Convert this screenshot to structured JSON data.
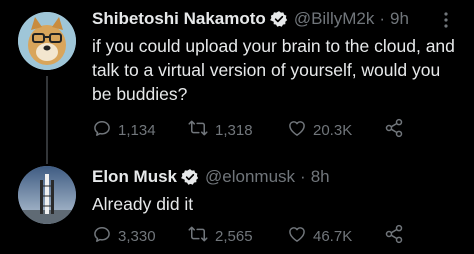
{
  "tweets": [
    {
      "name": "Shibetoshi Nakamoto",
      "handle": "@BillyM2k",
      "separator": "·",
      "time": "9h",
      "text": "if you could upload your brain to the cloud, and talk to a virtual version of yourself, would you be buddies?",
      "replies": "1,134",
      "retweets": "1,318",
      "likes": "20.3K"
    },
    {
      "name": "Elon Musk",
      "handle": "@elonmusk",
      "separator": "·",
      "time": "8h",
      "text": "Already did it",
      "replies": "3,330",
      "retweets": "2,565",
      "likes": "46.7K"
    }
  ],
  "colors": {
    "background": "#000000",
    "text": "#e7e9ea",
    "secondary": "#71767b",
    "thread_line": "#333639"
  },
  "icons": [
    "verified-badge-icon",
    "more-options-icon",
    "reply-icon",
    "retweet-icon",
    "like-icon",
    "share-icon"
  ]
}
